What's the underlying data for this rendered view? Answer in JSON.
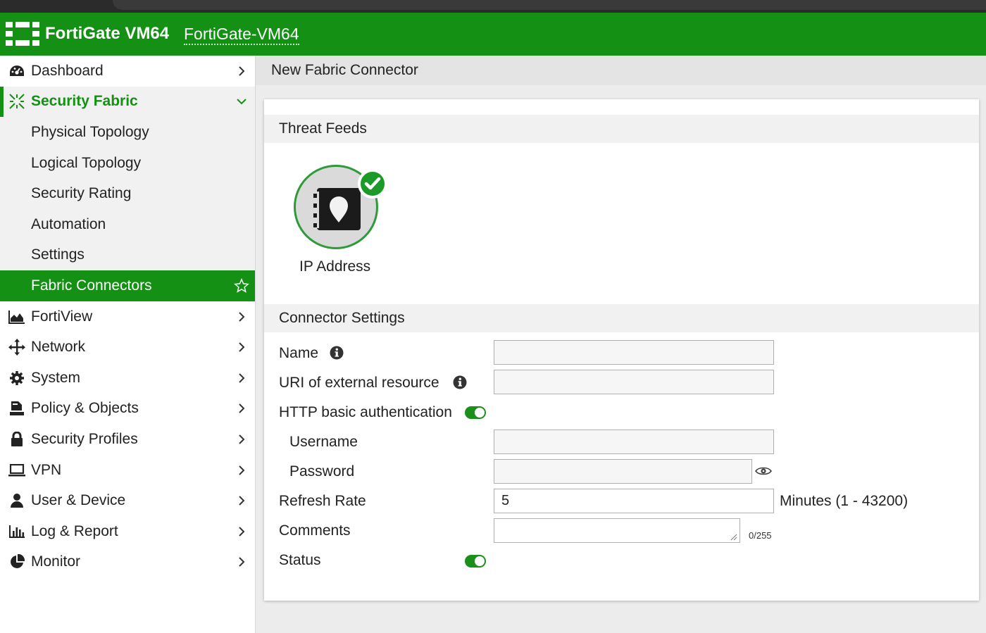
{
  "app": {
    "product_name": "FortiGate VM64",
    "hostname": "FortiGate-VM64"
  },
  "sidebar": {
    "items": [
      {
        "label": "Dashboard",
        "icon": "dashboard-icon"
      },
      {
        "label": "Security Fabric",
        "icon": "security-fabric-icon",
        "expanded": true
      },
      {
        "label": "Physical Topology"
      },
      {
        "label": "Logical Topology"
      },
      {
        "label": "Security Rating"
      },
      {
        "label": "Automation"
      },
      {
        "label": "Settings"
      },
      {
        "label": "Fabric Connectors",
        "active": true
      },
      {
        "label": "FortiView",
        "icon": "area-chart-icon"
      },
      {
        "label": "Network",
        "icon": "arrows-move-icon"
      },
      {
        "label": "System",
        "icon": "gear-icon"
      },
      {
        "label": "Policy & Objects",
        "icon": "policy-icon"
      },
      {
        "label": "Security Profiles",
        "icon": "lock-icon"
      },
      {
        "label": "VPN",
        "icon": "laptop-icon"
      },
      {
        "label": "User & Device",
        "icon": "user-icon"
      },
      {
        "label": "Log & Report",
        "icon": "bar-chart-icon"
      },
      {
        "label": "Monitor",
        "icon": "pie-chart-icon"
      }
    ]
  },
  "page": {
    "title": "New Fabric Connector"
  },
  "threat_feeds": {
    "section_title": "Threat Feeds",
    "selected_feed": "IP Address"
  },
  "connector_settings": {
    "section_title": "Connector Settings",
    "name_label": "Name",
    "name_value": "",
    "uri_label": "URI of external resource",
    "uri_value": "",
    "http_auth_label": "HTTP basic authentication",
    "http_auth_enabled": true,
    "username_label": "Username",
    "username_value": "",
    "password_label": "Password",
    "password_value": "",
    "refresh_label": "Refresh Rate",
    "refresh_value": "5",
    "refresh_suffix": "Minutes (1 - 43200)",
    "comments_label": "Comments",
    "comments_value": "",
    "comments_counter": "0/255",
    "status_label": "Status",
    "status_enabled": true
  },
  "colors": {
    "brand_green": "#149014",
    "toggle_green": "#1a8f1a"
  }
}
